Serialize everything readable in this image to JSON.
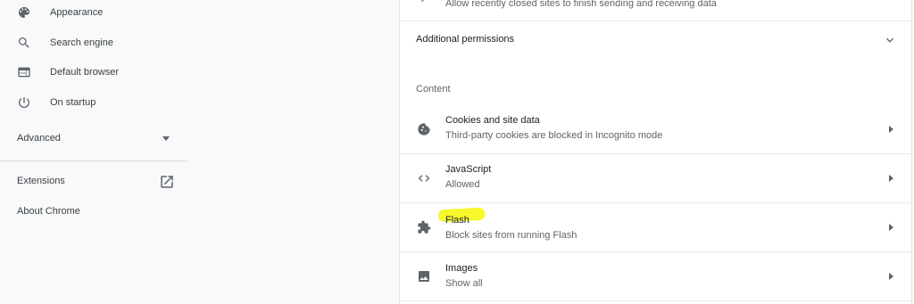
{
  "sidebar": {
    "items": [
      {
        "label": "Appearance",
        "icon": "palette-icon"
      },
      {
        "label": "Search engine",
        "icon": "search-icon"
      },
      {
        "label": "Default browser",
        "icon": "browser-window-icon"
      },
      {
        "label": "On startup",
        "icon": "power-icon"
      }
    ],
    "advanced_label": "Advanced",
    "extensions_label": "Extensions",
    "about_label": "About Chrome"
  },
  "main": {
    "top_partial_text": "Allow recently closed sites to finish sending and receiving data",
    "additional_permissions_label": "Additional permissions",
    "content_section_title": "Content",
    "content_rows": [
      {
        "title": "Cookies and site data",
        "subtitle": "Third-party cookies are blocked in Incognito mode",
        "icon": "cookie-icon"
      },
      {
        "title": "JavaScript",
        "subtitle": "Allowed",
        "icon": "code-brackets-icon"
      },
      {
        "title": "Flash",
        "subtitle": "Block sites from running Flash",
        "icon": "puzzle-piece-icon",
        "highlighted": true
      },
      {
        "title": "Images",
        "subtitle": "Show all",
        "icon": "image-icon"
      }
    ]
  },
  "colors": {
    "page_background": "#f8f9fa",
    "card_background": "#ffffff",
    "icon_gray": "#5f6368",
    "highlight_yellow": "#f7f72a"
  }
}
